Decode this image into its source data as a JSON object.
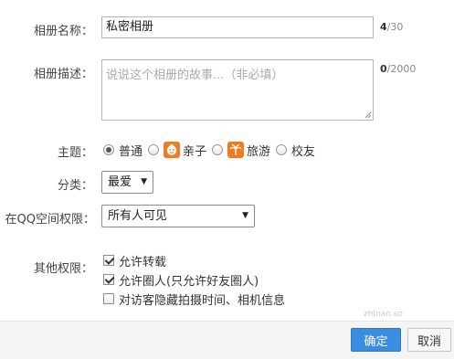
{
  "form": {
    "name_label": "相册名称：",
    "name_value": "私密相册",
    "name_count": "4",
    "name_max": "/30",
    "desc_label": "相册描述：",
    "desc_placeholder": "说说这个相册的故事...（非必填）",
    "desc_count": "0",
    "desc_max": "/2000",
    "theme_label": "主题：",
    "themes": [
      {
        "label": "普通",
        "selected": true
      },
      {
        "label": "亲子",
        "selected": false,
        "icon": "baby-face-icon"
      },
      {
        "label": "旅游",
        "selected": false,
        "icon": "palm-tree-icon"
      },
      {
        "label": "校友",
        "selected": false
      }
    ],
    "category_label": "分类：",
    "category_value": "最爱",
    "permission_label": "在QQ空间权限：",
    "permission_value": "所有人可见",
    "other_label": "其他权限：",
    "options": [
      {
        "label": "允许转载",
        "checked": true
      },
      {
        "label": "允许圈人(只允许好友圈人)",
        "checked": true
      },
      {
        "label": "对访客隐藏拍摄时间、相机信息",
        "checked": false
      }
    ]
  },
  "footer": {
    "ok_label": "确定",
    "cancel_label": "取消"
  },
  "watermark": "zhinan.so",
  "colors": {
    "accent": "#3a8de0",
    "theme_icon": "#f07b20"
  }
}
